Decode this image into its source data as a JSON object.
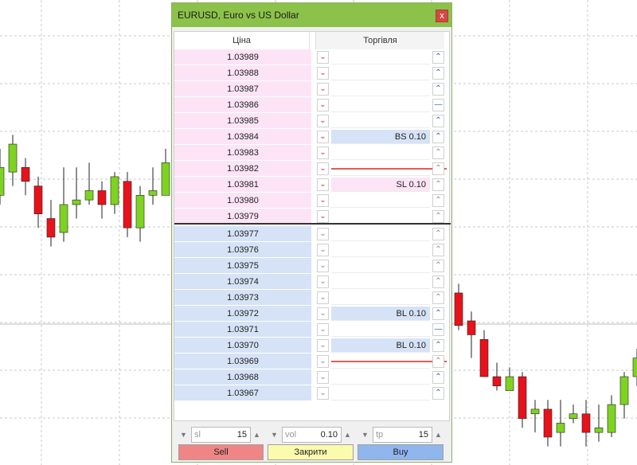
{
  "window": {
    "title": "EURUSD, Euro vs US Dollar",
    "close_glyph": "x"
  },
  "ladder": {
    "header_price": "Ціна",
    "header_trade": "Торгівля",
    "rows": [
      {
        "price": "1.03989",
        "side": "ask",
        "order": "",
        "buy_mark": "up"
      },
      {
        "price": "1.03988",
        "side": "ask",
        "order": "",
        "buy_mark": "up"
      },
      {
        "price": "1.03987",
        "side": "ask",
        "order": "",
        "buy_mark": "up"
      },
      {
        "price": "1.03986",
        "side": "ask",
        "order": "",
        "buy_mark": "level"
      },
      {
        "price": "1.03985",
        "side": "ask",
        "order": "",
        "buy_mark": "up"
      },
      {
        "price": "1.03984",
        "side": "ask",
        "order": "BS 0.10",
        "order_style": "blue",
        "buy_mark": "up"
      },
      {
        "price": "1.03983",
        "side": "ask",
        "order": "",
        "buy_mark": "grey"
      },
      {
        "price": "1.03982",
        "side": "ask",
        "order": "",
        "buy_mark": "line-red"
      },
      {
        "price": "1.03981",
        "side": "ask",
        "order": "SL 0.10",
        "order_style": "pink",
        "buy_mark": "grey"
      },
      {
        "price": "1.03980",
        "side": "ask",
        "order": "",
        "buy_mark": "grey"
      },
      {
        "price": "1.03979",
        "side": "ask",
        "order": "",
        "buy_mark": "grey"
      },
      {
        "price": "1.03977",
        "side": "bid",
        "order": "",
        "buy_mark": "grey"
      },
      {
        "price": "1.03976",
        "side": "bid",
        "order": "",
        "buy_mark": "grey"
      },
      {
        "price": "1.03975",
        "side": "bid",
        "order": "",
        "buy_mark": "grey"
      },
      {
        "price": "1.03974",
        "side": "bid",
        "order": "",
        "buy_mark": "grey"
      },
      {
        "price": "1.03973",
        "side": "bid",
        "order": "",
        "buy_mark": "grey"
      },
      {
        "price": "1.03972",
        "side": "bid",
        "order": "BL 0.10",
        "order_style": "blue",
        "buy_mark": "up"
      },
      {
        "price": "1.03971",
        "side": "bid",
        "order": "",
        "buy_mark": "level"
      },
      {
        "price": "1.03970",
        "side": "bid",
        "order": "BL 0.10",
        "order_style": "blue",
        "buy_mark": "up"
      },
      {
        "price": "1.03969",
        "side": "bid",
        "order": "",
        "buy_mark": "line-red"
      },
      {
        "price": "1.03968",
        "side": "bid",
        "order": "",
        "buy_mark": "up"
      },
      {
        "price": "1.03967",
        "side": "bid",
        "order": "",
        "buy_mark": "up"
      }
    ]
  },
  "controls": {
    "sl": {
      "placeholder": "sl",
      "value": "15"
    },
    "vol": {
      "placeholder": "vol",
      "value": "0.10"
    },
    "tp": {
      "placeholder": "tp",
      "value": "15"
    }
  },
  "buttons": {
    "sell": "Sell",
    "close": "Закрити",
    "buy": "Buy"
  },
  "colors": {
    "title_bar": "#8cc24a",
    "ask_row": "#fce4f6",
    "bid_row": "#d6e3f6",
    "bull_candle": "#7ed321",
    "bear_candle": "#e8121b",
    "sell_button": "#f08585",
    "close_button": "#fbfbae",
    "buy_button": "#90b6ee",
    "order_line": "#e05a5a"
  },
  "chart": {
    "candles_left": [
      {
        "o": 0.42,
        "c": 0.36,
        "h": 0.32,
        "l": 0.44
      },
      {
        "o": 0.37,
        "c": 0.31,
        "h": 0.29,
        "l": 0.4
      },
      {
        "o": 0.36,
        "c": 0.39,
        "h": 0.34,
        "l": 0.42
      },
      {
        "o": 0.4,
        "c": 0.46,
        "h": 0.38,
        "l": 0.49
      },
      {
        "o": 0.47,
        "c": 0.51,
        "h": 0.43,
        "l": 0.53
      },
      {
        "o": 0.5,
        "c": 0.44,
        "h": 0.36,
        "l": 0.52
      },
      {
        "o": 0.44,
        "c": 0.43,
        "h": 0.36,
        "l": 0.47
      },
      {
        "o": 0.43,
        "c": 0.41,
        "h": 0.35,
        "l": 0.44
      },
      {
        "o": 0.41,
        "c": 0.44,
        "h": 0.39,
        "l": 0.47
      },
      {
        "o": 0.44,
        "c": 0.38,
        "h": 0.37,
        "l": 0.46
      },
      {
        "o": 0.39,
        "c": 0.49,
        "h": 0.37,
        "l": 0.51
      },
      {
        "o": 0.49,
        "c": 0.42,
        "h": 0.4,
        "l": 0.52
      },
      {
        "o": 0.42,
        "c": 0.41,
        "h": 0.36,
        "l": 0.44
      },
      {
        "o": 0.42,
        "c": 0.35,
        "h": 0.32,
        "l": 0.42
      }
    ],
    "candles_right": [
      {
        "o": 0.63,
        "c": 0.7,
        "h": 0.61,
        "l": 0.71
      },
      {
        "o": 0.69,
        "c": 0.72,
        "h": 0.67,
        "l": 0.77
      },
      {
        "o": 0.73,
        "c": 0.81,
        "h": 0.71,
        "l": 0.81
      },
      {
        "o": 0.81,
        "c": 0.83,
        "h": 0.78,
        "l": 0.84
      },
      {
        "o": 0.84,
        "c": 0.81,
        "h": 0.79,
        "l": 0.84
      },
      {
        "o": 0.81,
        "c": 0.9,
        "h": 0.8,
        "l": 0.92
      },
      {
        "o": 0.89,
        "c": 0.88,
        "h": 0.86,
        "l": 0.93
      },
      {
        "o": 0.88,
        "c": 0.94,
        "h": 0.86,
        "l": 0.96
      },
      {
        "o": 0.93,
        "c": 0.91,
        "h": 0.86,
        "l": 0.96
      },
      {
        "o": 0.9,
        "c": 0.89,
        "h": 0.87,
        "l": 0.91
      },
      {
        "o": 0.89,
        "c": 0.93,
        "h": 0.86,
        "l": 0.96
      },
      {
        "o": 0.93,
        "c": 0.92,
        "h": 0.87,
        "l": 0.95
      },
      {
        "o": 0.93,
        "c": 0.87,
        "h": 0.85,
        "l": 0.94
      },
      {
        "o": 0.87,
        "c": 0.81,
        "h": 0.8,
        "l": 0.9
      },
      {
        "o": 0.81,
        "c": 0.77,
        "h": 0.75,
        "l": 0.83
      }
    ]
  }
}
